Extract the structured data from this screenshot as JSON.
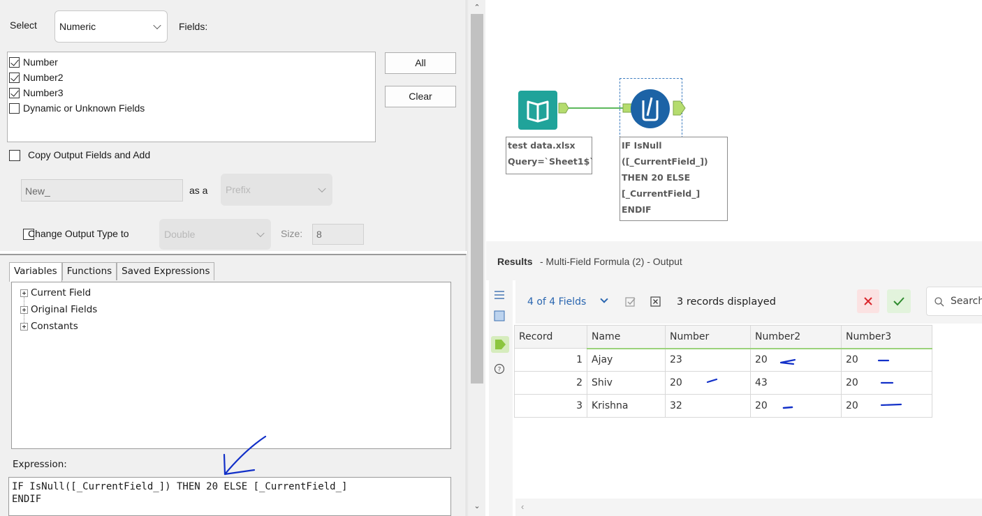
{
  "config": {
    "select_label": "Select",
    "select_value": "Numeric",
    "fields_label": "Fields:",
    "fields": [
      {
        "label": "Number",
        "checked": true
      },
      {
        "label": "Number2",
        "checked": true
      },
      {
        "label": "Number3",
        "checked": true
      },
      {
        "label": "Dynamic or Unknown Fields",
        "checked": false
      }
    ],
    "all_button": "All",
    "clear_button": "Clear",
    "copy_output_label": "Copy Output Fields and Add",
    "prefix_input_value": "New_",
    "as_a_label": "as a",
    "prefix_select_value": "Prefix",
    "change_type_label": "Change Output Type to",
    "type_select_value": "Double",
    "size_label": "Size:",
    "size_value": "8"
  },
  "tabs": [
    "Variables",
    "Functions",
    "Saved Expressions"
  ],
  "tree": [
    "Current Field",
    "Original Fields",
    "Constants"
  ],
  "expression": {
    "label": "Expression:",
    "text": "IF IsNull([_CurrentField_]) THEN 20 ELSE [_CurrentField_]\nENDIF"
  },
  "workflow": {
    "input_annotation": [
      "test data.xlsx",
      "Query=`Sheet1$`"
    ],
    "formula_annotation": [
      "IF IsNull",
      "([_CurrentField_])",
      "THEN 20 ELSE",
      "[_CurrentField_]",
      "ENDIF"
    ],
    "input_color": "#20a39a",
    "formula_color": "#1c63a6",
    "connector_color": "#5cb85c"
  },
  "results": {
    "title": "Results",
    "subtitle": " - Multi-Field Formula (2) - Output",
    "fields_selector": "4 of 4 Fields",
    "records_displayed": "3 records displayed",
    "search_placeholder": "Search",
    "columns": [
      "Record",
      "Name",
      "Number",
      "Number2",
      "Number3"
    ],
    "rows": [
      [
        "1",
        "Ajay",
        "23",
        "20",
        "20"
      ],
      [
        "2",
        "Shiv",
        "20",
        "43",
        "20"
      ],
      [
        "3",
        "Krishna",
        "32",
        "20",
        "20"
      ]
    ]
  }
}
